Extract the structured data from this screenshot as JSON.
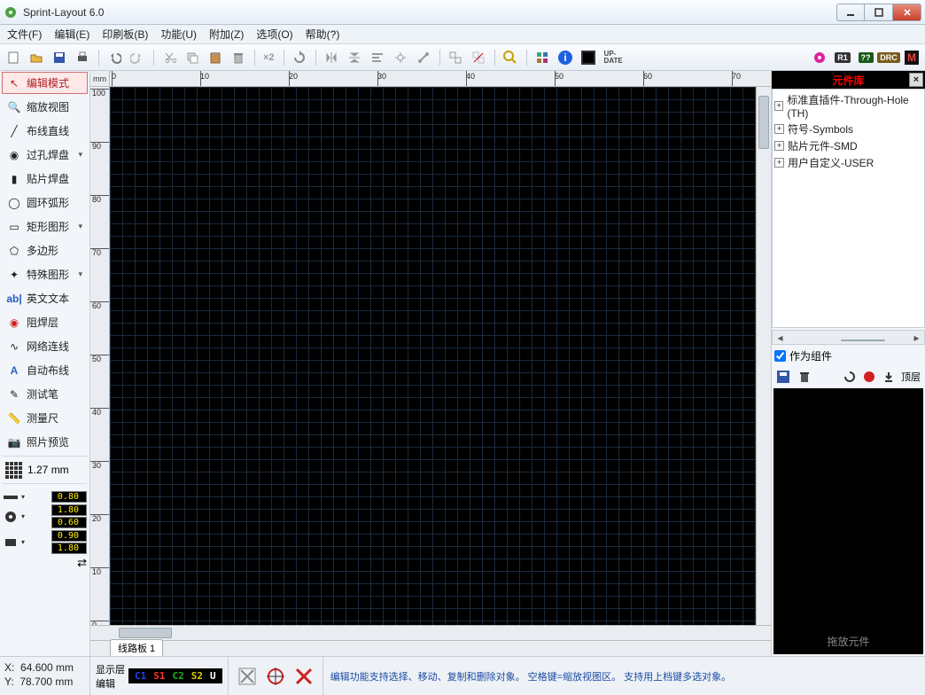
{
  "title": "Sprint-Layout 6.0",
  "menu": {
    "file": "文件(F)",
    "edit": "编辑(E)",
    "pcb": "印刷板(B)",
    "func": "功能(U)",
    "add": "附加(Z)",
    "opt": "选项(O)",
    "help": "帮助(?)"
  },
  "toolbar": {
    "x2": "×2",
    "update": "UP-\nDATE",
    "r1": "R1",
    "q": "??",
    "drc": "DRC"
  },
  "tools": {
    "editmode": "编辑模式",
    "zoomview": "缩放视图",
    "line": "布线直线",
    "pad": "过孔焊盘",
    "smd": "贴片焊盘",
    "arc": "圆环弧形",
    "rect": "矩形图形",
    "poly": "多边形",
    "special": "特殊图形",
    "text": "英文文本",
    "mask": "阻焊层",
    "net": "网络连线",
    "autoroute": "自动布线",
    "testpen": "测试笔",
    "measure": "测量尺",
    "photo": "照片预览"
  },
  "grid_value": "1.27 mm",
  "params": {
    "p1": "0.80",
    "p2a": "1.80",
    "p2b": "0.60",
    "p3a": "0.90",
    "p3b": "1.80"
  },
  "ruler_unit": "mm",
  "h_ticks": [
    "0",
    "10",
    "20",
    "30",
    "40",
    "50",
    "60",
    "70"
  ],
  "v_ticks": [
    "100",
    "90",
    "80",
    "70",
    "60",
    "50",
    "40",
    "30",
    "20",
    "10",
    "0"
  ],
  "tab_name": "线路板 1",
  "library": {
    "title": "元件库",
    "groups": [
      "标准直插件-Through-Hole (TH)",
      "符号-Symbols",
      "贴片元件-SMD",
      "用户自定义-USER"
    ],
    "as_component": "作为组件",
    "layer_label": "顶层",
    "drop_hint": "拖放元件"
  },
  "status": {
    "x_label": "X:",
    "x_val": "64.600 mm",
    "y_label": "Y:",
    "y_val": "78.700 mm",
    "layer_label": "显示层",
    "edit_label": "编辑",
    "layers": [
      {
        "name": "C1",
        "color": "#2040ff"
      },
      {
        "name": "S1",
        "color": "#ff3030"
      },
      {
        "name": "C2",
        "color": "#20b020"
      },
      {
        "name": "S2",
        "color": "#e0d000"
      },
      {
        "name": "U",
        "color": "#ffffff"
      }
    ],
    "hint": "编辑功能支持选择、移动、复制和删除对象。 空格键=缩放视图区。 支持用上档键多选对象。"
  }
}
